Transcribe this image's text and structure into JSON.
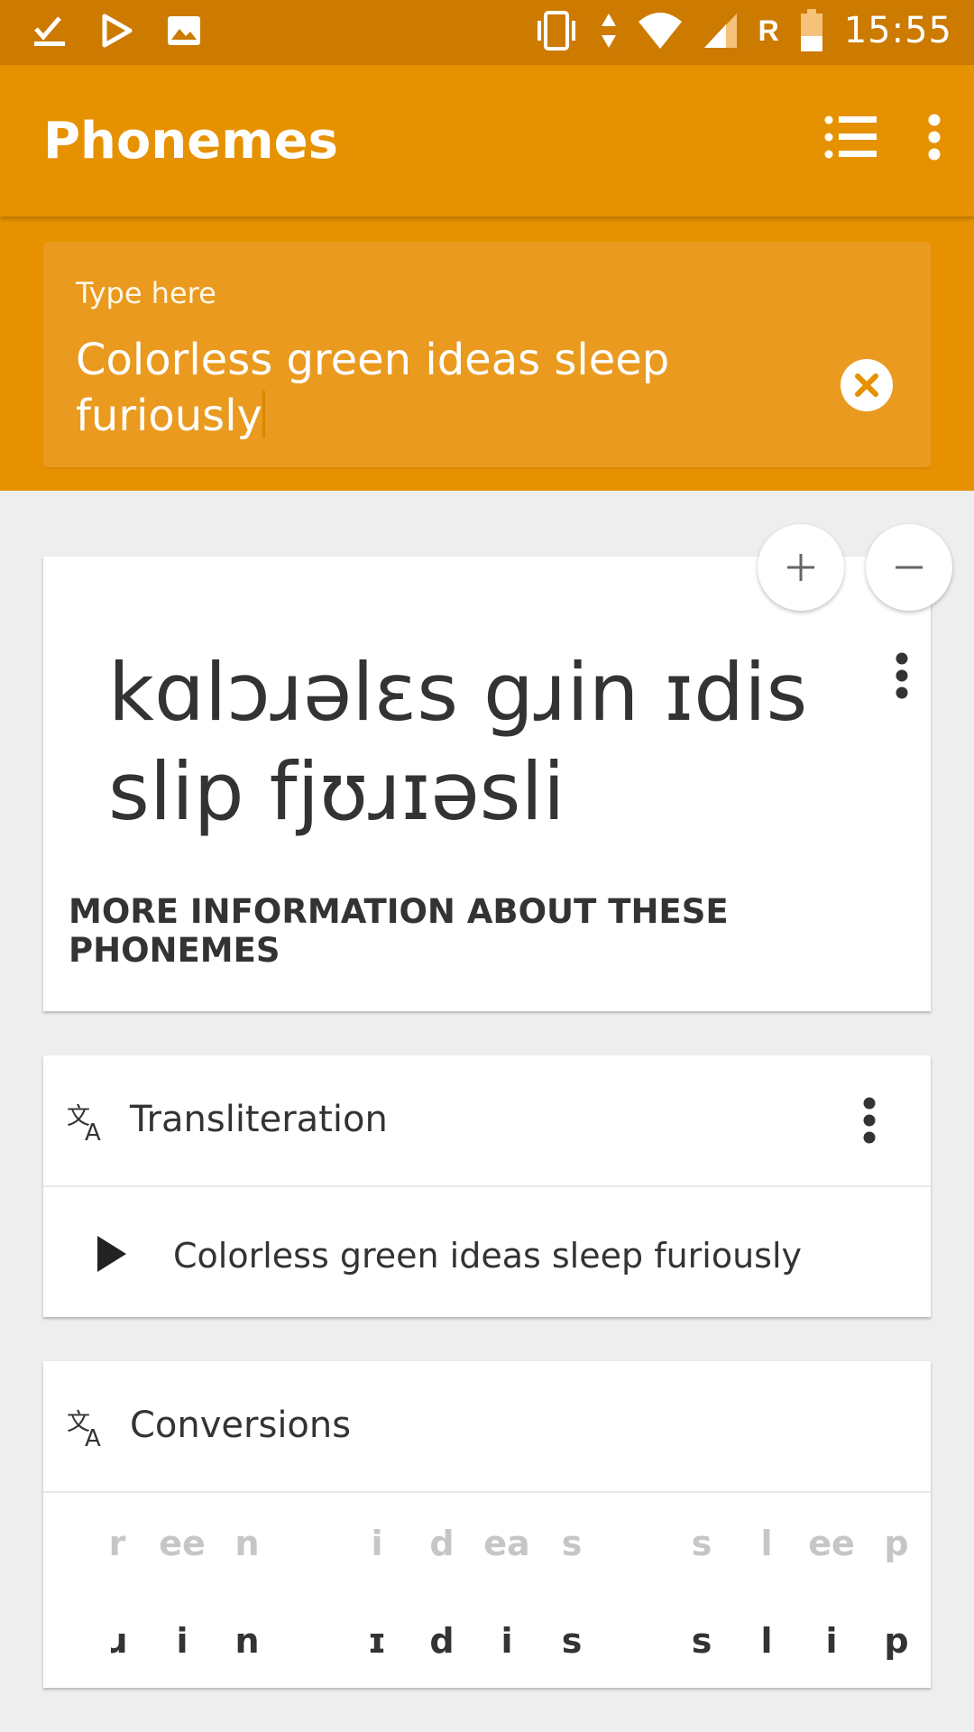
{
  "status_bar": {
    "time": "15:55",
    "roaming": "R"
  },
  "app_bar": {
    "title": "Phonemes"
  },
  "input": {
    "label": "Type here",
    "value": "Colorless green ideas sleep furiously"
  },
  "phoneme_card": {
    "ipa": "kɑlɔɹəlɛs gɹin ɪdis slip fjʊɹɪəsli",
    "more_info": "MORE INFORMATION ABOUT THESE PHONEMES",
    "zoom_in": "+",
    "zoom_out": "−"
  },
  "transliteration": {
    "title": "Transliteration",
    "text": "Colorless green ideas sleep furiously"
  },
  "conversions": {
    "title": "Conversions",
    "source": [
      "r",
      "ee",
      "n",
      "i",
      "d",
      "ea",
      "s",
      "s",
      "l",
      "ee",
      "p"
    ],
    "target": [
      "ɹ",
      "i",
      "n",
      "ɪ",
      "d",
      "i",
      "s",
      "s",
      "l",
      "i",
      "p"
    ]
  },
  "colors": {
    "status_bar": "#cc7a00",
    "primary": "#e69100",
    "input_bg": "#e99a1f",
    "background": "#eeeeee"
  }
}
